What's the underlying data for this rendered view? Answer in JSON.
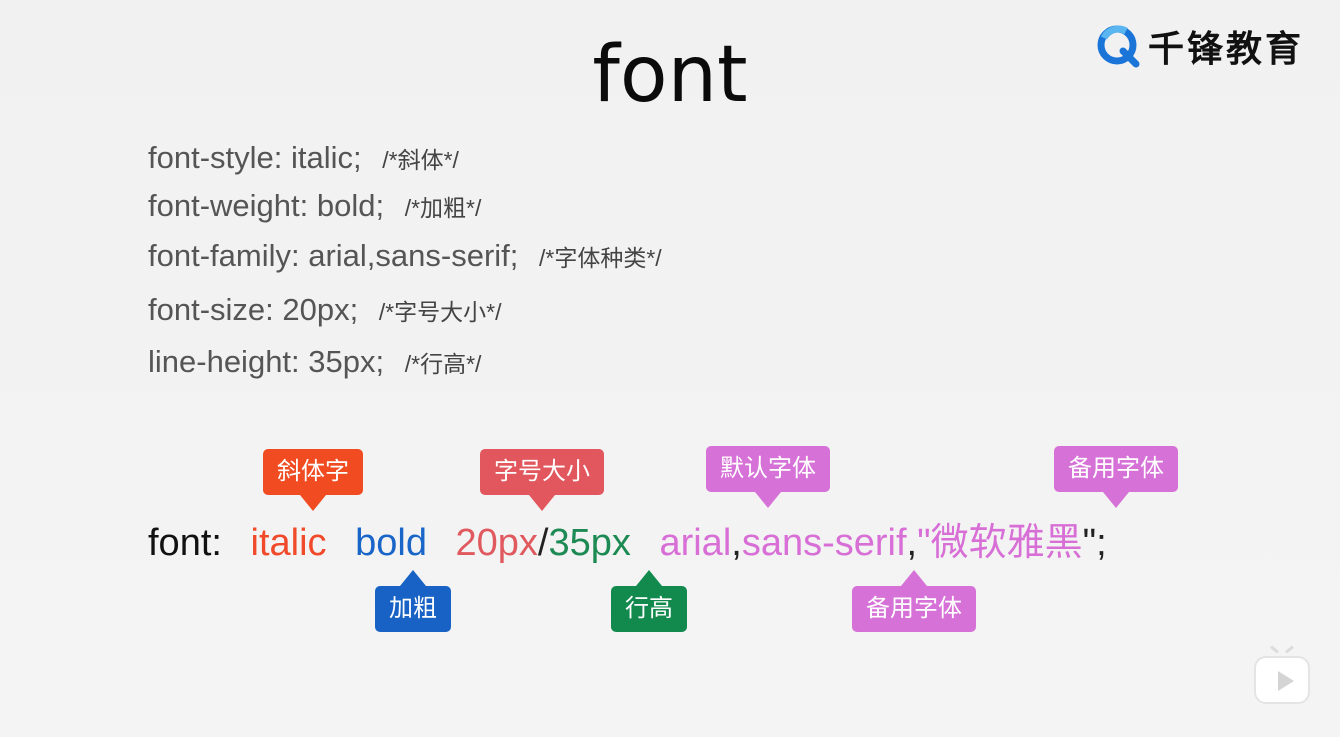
{
  "title": "font",
  "logo": {
    "icon": "qianfeng-q-logo-icon",
    "text": "千锋教育",
    "colors": {
      "blue": "#1b74d8",
      "light_blue": "#59b6f0"
    }
  },
  "properties": [
    {
      "code": "font-style: italic;",
      "comment": "/*斜体*/"
    },
    {
      "code": "font-weight: bold;",
      "comment": "/*加粗*/"
    },
    {
      "code": "font-family: arial,sans-serif;",
      "comment": "/*字体种类*/"
    },
    {
      "code": "font-size: 20px;",
      "comment": "/*字号大小*/"
    },
    {
      "code": "line-height: 35px;",
      "comment": "/*行高*/"
    }
  ],
  "shorthand": {
    "prop": "font:",
    "italic": "italic",
    "bold": "bold",
    "size": "20px",
    "slash": "/",
    "line_height": "35px",
    "family_primary": "arial",
    "comma1": ",",
    "family_fallback": "sans-serif",
    "comma2": ",",
    "quote_open": "\"",
    "family_cn": "微软雅黑",
    "quote_close": "\";"
  },
  "callouts": {
    "italic": "斜体字",
    "bold": "加粗",
    "size": "字号大小",
    "line_height": "行高",
    "default_font": "默认字体",
    "fallback_font_1": "备用字体",
    "fallback_font_2": "备用字体"
  },
  "colors": {
    "italic": "#f04a2a",
    "bold": "#1a66c8",
    "size": "#e0595f",
    "line_height": "#1c8a52",
    "font_family": "#d86fd6"
  },
  "player": {
    "icon": "play-icon"
  }
}
